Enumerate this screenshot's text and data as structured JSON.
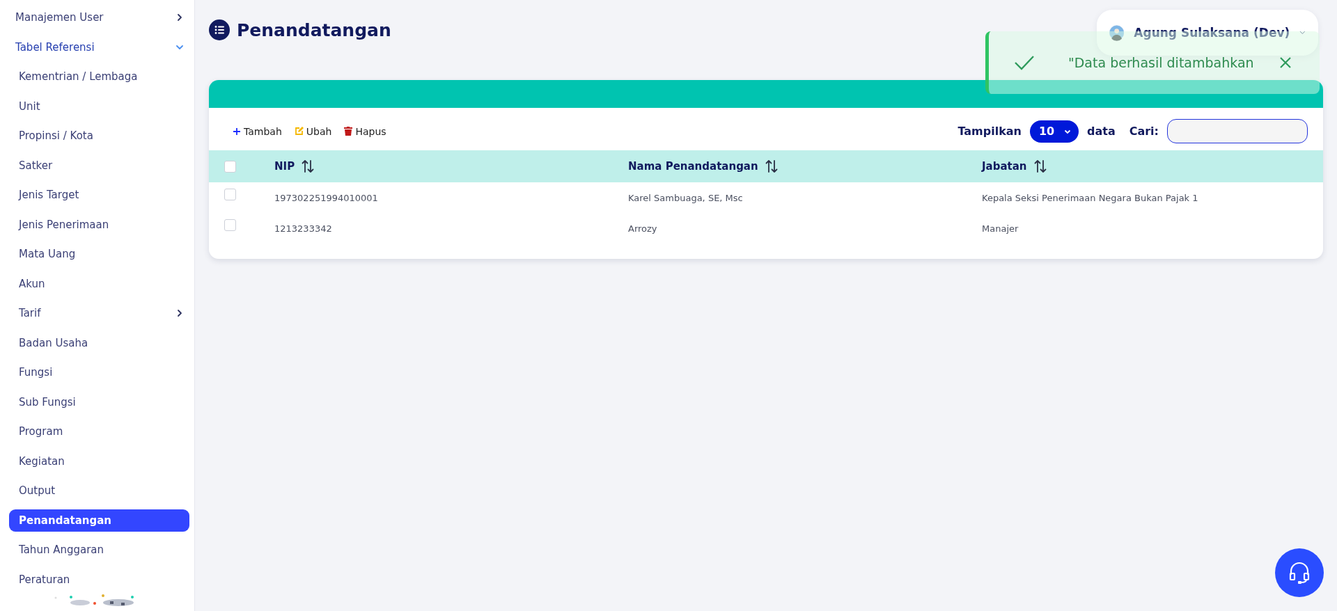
{
  "sidebar": {
    "items": [
      {
        "label": "Manajemen User",
        "expanded": false,
        "selected": false
      },
      {
        "label": "Tabel Referensi",
        "expanded": true,
        "selected": false,
        "children": [
          {
            "label": "Kementrian / Lembaga",
            "selected": false
          },
          {
            "label": "Unit",
            "selected": false
          },
          {
            "label": "Propinsi / Kota",
            "selected": false
          },
          {
            "label": "Satker",
            "selected": false
          },
          {
            "label": "Jenis Target",
            "selected": false
          },
          {
            "label": "Jenis Penerimaan",
            "selected": false
          },
          {
            "label": "Mata Uang",
            "selected": false
          },
          {
            "label": "Akun",
            "selected": false
          },
          {
            "label": "Tarif",
            "expanded": false,
            "selected": false
          },
          {
            "label": "Badan Usaha",
            "selected": false
          },
          {
            "label": "Fungsi",
            "selected": false
          },
          {
            "label": "Sub Fungsi",
            "selected": false
          },
          {
            "label": "Program",
            "selected": false
          },
          {
            "label": "Kegiatan",
            "selected": false
          },
          {
            "label": "Output",
            "selected": false
          },
          {
            "label": "Penandatangan",
            "selected": true
          },
          {
            "label": "Tahun Anggaran",
            "selected": false
          },
          {
            "label": "Peraturan",
            "selected": false
          }
        ]
      }
    ]
  },
  "page": {
    "title": "Penandatangan"
  },
  "user": {
    "name": "Agung Sulaksana (Dev)"
  },
  "toast": {
    "message": "\"Data berhasil ditambahkan"
  },
  "toolbar": {
    "actions": [
      {
        "label": "Tambah",
        "kind": "add"
      },
      {
        "label": "Ubah",
        "kind": "edit"
      },
      {
        "label": "Hapus",
        "kind": "delete"
      }
    ],
    "show_label": "Tampilkan",
    "page_size": "10",
    "show_suffix": "data",
    "search_label": "Cari:"
  },
  "table": {
    "select_all_checked": false,
    "columns": [
      {
        "label": "NIP",
        "sortable": true
      },
      {
        "label": "Nama Penandatangan",
        "sortable": true
      },
      {
        "label": "Jabatan",
        "sortable": true
      }
    ],
    "rows": [
      {
        "checked": false,
        "cells": [
          "197302251994010001",
          "Karel Sambuaga, SE, Msc",
          "Kepala Seksi Penerimaan Negara Bukan Pajak 1"
        ]
      },
      {
        "checked": false,
        "cells": [
          "1213233342",
          "Arrozy",
          "Manajer"
        ]
      }
    ]
  }
}
